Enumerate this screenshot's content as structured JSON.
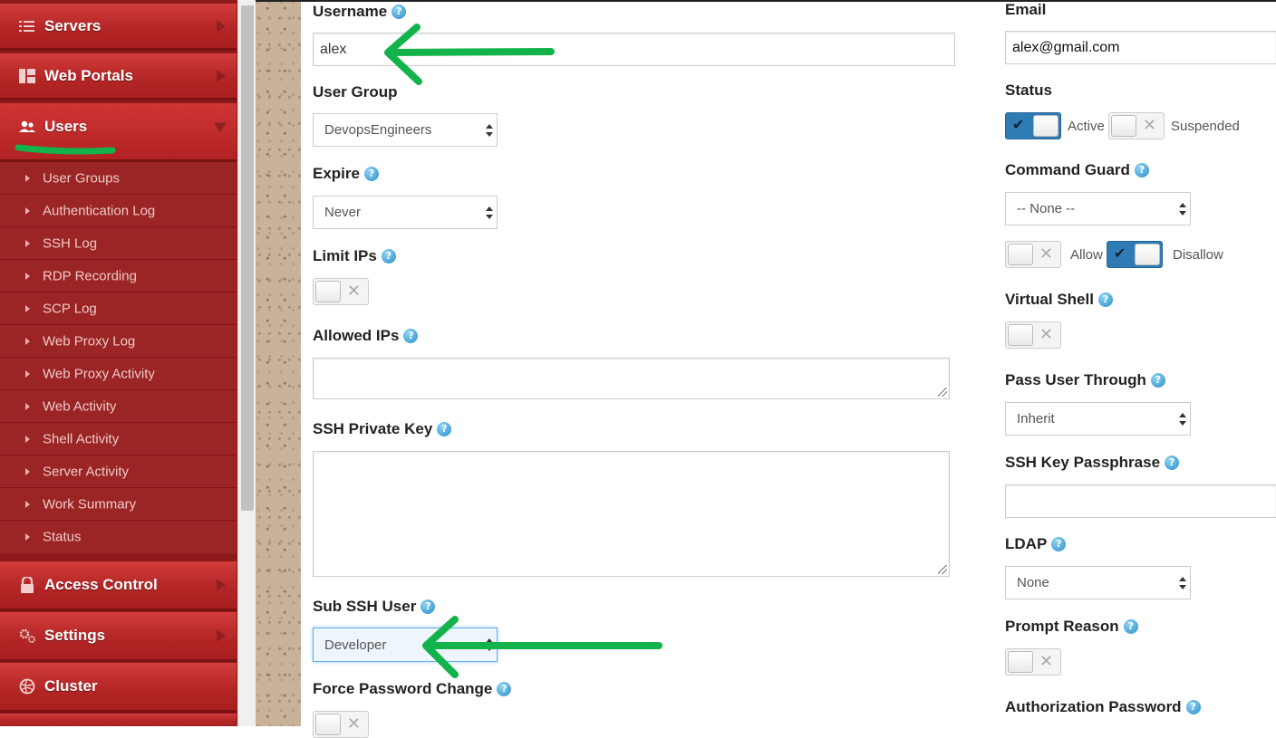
{
  "sidebar": {
    "menu": [
      {
        "label": "Servers",
        "icon": "list-icon"
      },
      {
        "label": "Web Portals",
        "icon": "dashboard-icon"
      },
      {
        "label": "Users",
        "icon": "users-icon"
      },
      {
        "label": "Access Control",
        "icon": "lock-icon"
      },
      {
        "label": "Settings",
        "icon": "gears-icon"
      },
      {
        "label": "Cluster",
        "icon": "globe-icon"
      }
    ],
    "users_submenu": [
      "User Groups",
      "Authentication Log",
      "SSH Log",
      "RDP Recording",
      "SCP Log",
      "Web Proxy Log",
      "Web Proxy Activity",
      "Web Activity",
      "Shell Activity",
      "Server Activity",
      "Work Summary",
      "Status"
    ]
  },
  "form": {
    "username": {
      "label": "Username",
      "value": "alex"
    },
    "user_group": {
      "label": "User Group",
      "value": "DevopsEngineers"
    },
    "expire": {
      "label": "Expire",
      "value": "Never"
    },
    "limit_ips": {
      "label": "Limit IPs",
      "enabled": false
    },
    "allowed_ips": {
      "label": "Allowed IPs",
      "value": ""
    },
    "ssh_private_key": {
      "label": "SSH Private Key",
      "value": ""
    },
    "sub_ssh_user": {
      "label": "Sub SSH User",
      "value": "Developer"
    },
    "force_password_change": {
      "label": "Force Password Change",
      "enabled": false
    },
    "email": {
      "label": "Email",
      "value": "alex@gmail.com"
    },
    "status": {
      "label": "Status",
      "active_label": "Active",
      "suspended_label": "Suspended",
      "active": true,
      "suspended": false
    },
    "command_guard": {
      "label": "Command Guard",
      "value": "-- None --",
      "allow_label": "Allow",
      "disallow_label": "Disallow",
      "allow": false,
      "disallow": true
    },
    "virtual_shell": {
      "label": "Virtual Shell",
      "enabled": false
    },
    "pass_user_through": {
      "label": "Pass User Through",
      "value": "Inherit"
    },
    "ssh_key_passphrase": {
      "label": "SSH Key Passphrase",
      "value": ""
    },
    "ldap": {
      "label": "LDAP",
      "value": "None"
    },
    "prompt_reason": {
      "label": "Prompt Reason",
      "enabled": false
    },
    "authorization_password": {
      "label": "Authorization Password"
    }
  },
  "help_glyph": "?",
  "toggle_marks": {
    "off": "✕",
    "on": "✔"
  },
  "colors": {
    "sidebar_red": "#b52626",
    "toggle_on": "#2f7cb5",
    "annotation_green": "#12b34a"
  }
}
